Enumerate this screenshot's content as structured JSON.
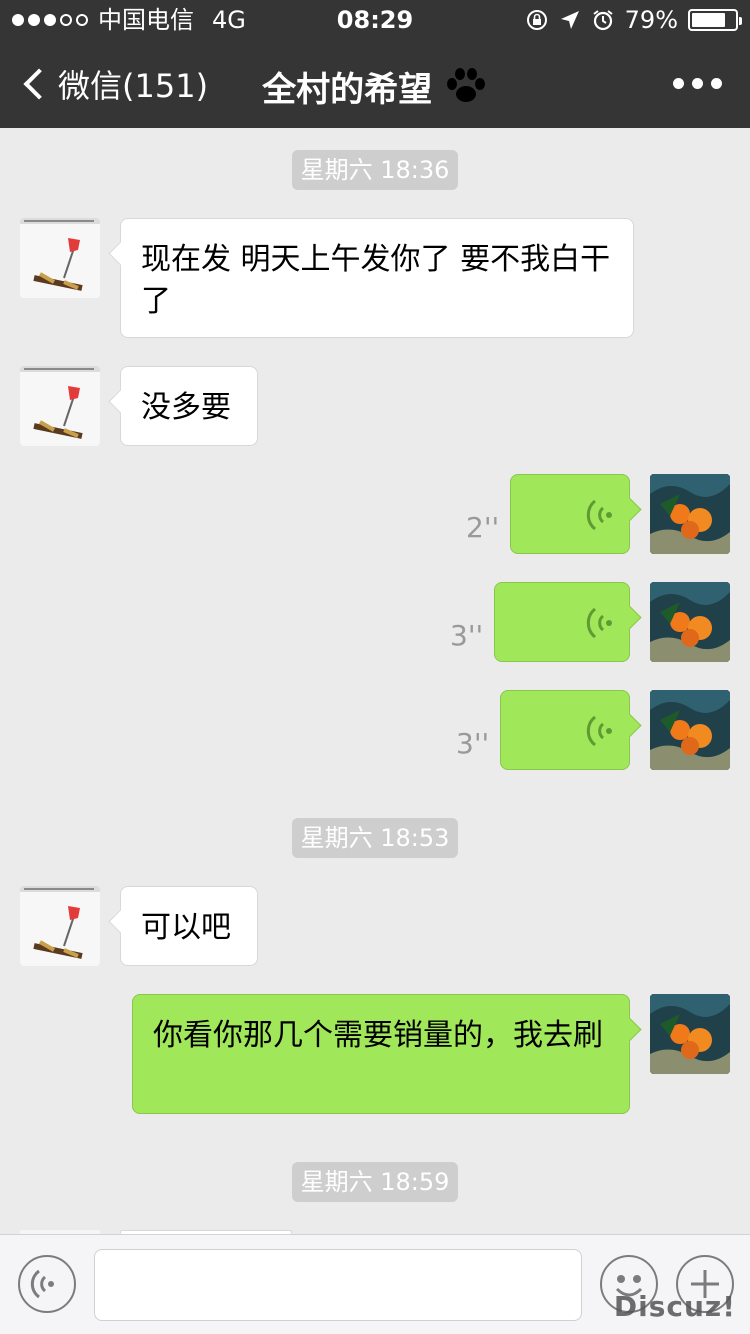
{
  "status_bar": {
    "carrier": "中国电信",
    "network": "4G",
    "time": "08:29",
    "battery": "79%",
    "battery_level": 0.79
  },
  "nav": {
    "back_label": "微信(151)",
    "title": "全村的希望",
    "title_icon": "paw-icon",
    "more_icon": "more-icon"
  },
  "messages": {
    "ts1": "星期六 18:36",
    "m1": "现在发 明天上午发你了 要不我白干了",
    "m2": "没多要",
    "v1_duration": "2''",
    "v2_duration": "3''",
    "v3_duration": "3''",
    "ts2": "星期六 18:53",
    "m3": "可以吧",
    "m4": "你看你那几个需要销量的，我去刷",
    "ts3": "星期六 18:59"
  },
  "input_bar": {
    "voice_icon": "voice-icon",
    "emoji_icon": "emoji-icon",
    "add_icon": "plus-icon"
  },
  "watermark": "Discuz!",
  "colors": {
    "nav_bg": "#353535",
    "chat_bg": "#ebebeb",
    "self_bubble": "#a0e75a",
    "peer_bubble": "#ffffff"
  }
}
